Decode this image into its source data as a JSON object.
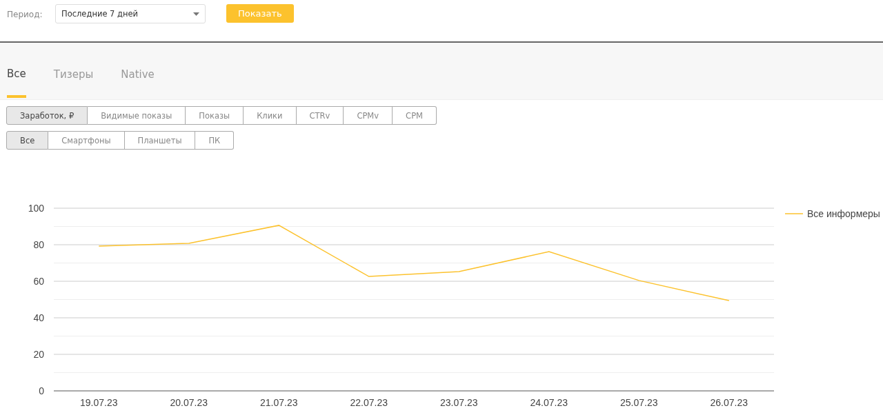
{
  "filter": {
    "label": "Период:",
    "period": "Последние 7 дней",
    "button": "Показать"
  },
  "tabs": [
    {
      "label": "Все",
      "selected": true
    },
    {
      "label": "Тизеры",
      "selected": false
    },
    {
      "label": "Native",
      "selected": false
    }
  ],
  "metrics": [
    {
      "label": "Заработок, ₽",
      "selected": true
    },
    {
      "label": "Видимые показы",
      "selected": false
    },
    {
      "label": "Показы",
      "selected": false
    },
    {
      "label": "Клики",
      "selected": false
    },
    {
      "label": "CTRv",
      "selected": false
    },
    {
      "label": "CPMv",
      "selected": false
    },
    {
      "label": "CPM",
      "selected": false
    }
  ],
  "devices": [
    {
      "label": "Все",
      "selected": true
    },
    {
      "label": "Смартфоны",
      "selected": false
    },
    {
      "label": "Планшеты",
      "selected": false
    },
    {
      "label": "ПК",
      "selected": false
    }
  ],
  "chart_data": {
    "type": "line",
    "categories": [
      "19.07.23",
      "20.07.23",
      "21.07.23",
      "22.07.23",
      "23.07.23",
      "24.07.23",
      "25.07.23",
      "26.07.23"
    ],
    "series": [
      {
        "name": "Все информеры",
        "color": "#fcc22d",
        "values": [
          79.2,
          80.8,
          90.6,
          62.6,
          65.3,
          76.2,
          60.4,
          49.4
        ]
      }
    ],
    "grid": true,
    "ylim": [
      0,
      100
    ],
    "yticks": [
      0,
      20,
      40,
      60,
      80,
      100
    ]
  }
}
